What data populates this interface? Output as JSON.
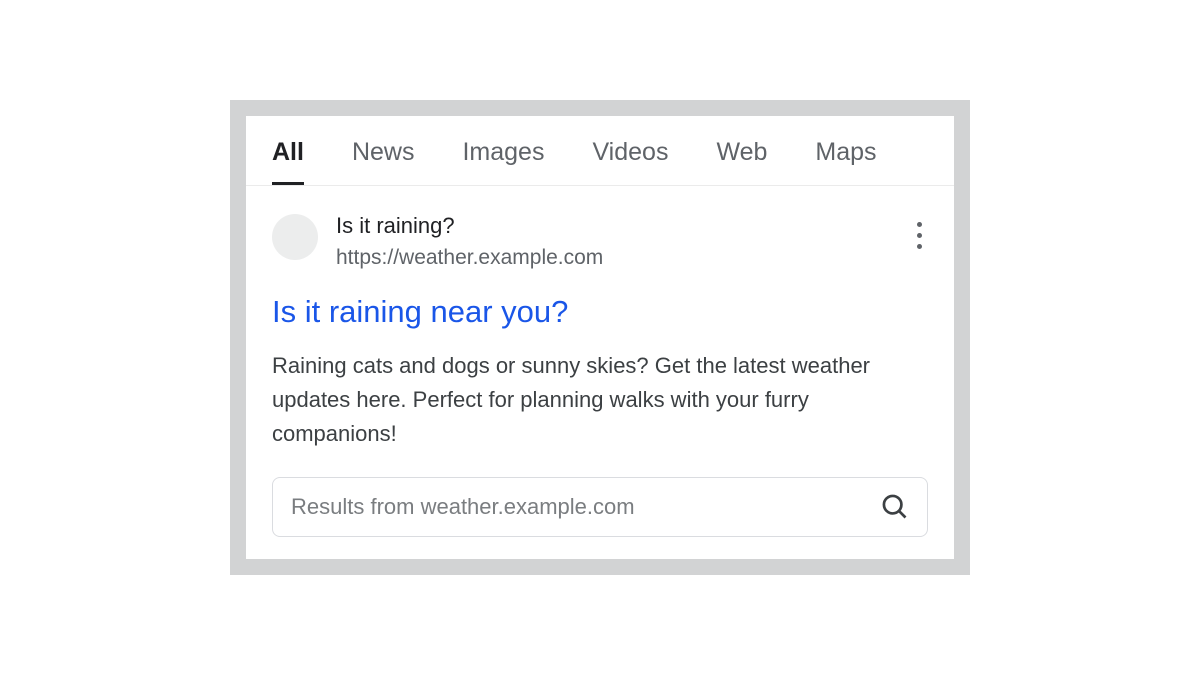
{
  "tabs": {
    "items": [
      "All",
      "News",
      "Images",
      "Videos",
      "Web",
      "Maps"
    ],
    "active_index": 0
  },
  "result": {
    "site_name": "Is it raining?",
    "url": "https://weather.example.com",
    "title": "Is it raining near you?",
    "description": "Raining cats and dogs or sunny skies? Get the latest weather updates here. Perfect for planning walks with your furry companions!"
  },
  "sitelinks_search": {
    "placeholder": "Results from weather.example.com"
  },
  "colors": {
    "link": "#1a56e8",
    "text": "#202124",
    "muted": "#5f6368"
  }
}
